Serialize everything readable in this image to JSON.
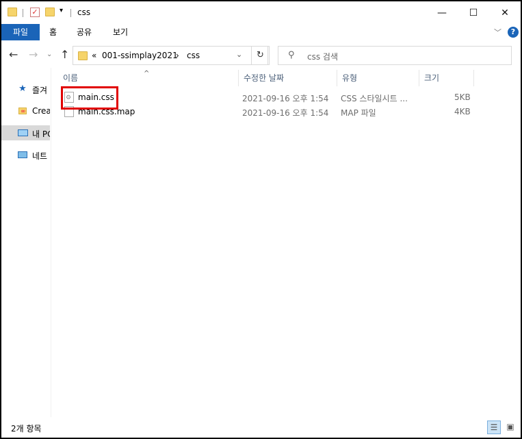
{
  "window": {
    "title": "css",
    "controls": {
      "minimize": "—",
      "maximize": "☐",
      "close": "✕"
    }
  },
  "ribbon": {
    "tabs": [
      "파일",
      "홈",
      "공유",
      "보기"
    ],
    "help": "?"
  },
  "address": {
    "prefix": "«",
    "segments": [
      "001-ssimplay2021",
      "css"
    ],
    "separator": "›"
  },
  "search": {
    "placeholder": "css 검색"
  },
  "sidebar": {
    "items": [
      {
        "label": "즐겨",
        "icon": "star-icon"
      },
      {
        "label": "Creat",
        "icon": "creative-cloud-icon"
      },
      {
        "label": "내 PC",
        "icon": "computer-icon",
        "selected": true
      },
      {
        "label": "네트",
        "icon": "network-icon"
      }
    ]
  },
  "columns": {
    "name": "이름",
    "modified": "수정한 날짜",
    "type": "유형",
    "size": "크기"
  },
  "files": [
    {
      "name": "main.css",
      "modified": "2021-09-16 오후 1:54",
      "type": "CSS 스타일시트 ...",
      "size": "5KB",
      "highlighted": true
    },
    {
      "name": "main.css.map",
      "modified": "2021-09-16 오후 1:54",
      "type": "MAP 파일",
      "size": "4KB"
    }
  ],
  "status": {
    "item_count": "2개 항목"
  },
  "colors": {
    "accent": "#1a64b8",
    "highlight": "#e10000",
    "selected_sidebar": "#d9d9d9"
  }
}
